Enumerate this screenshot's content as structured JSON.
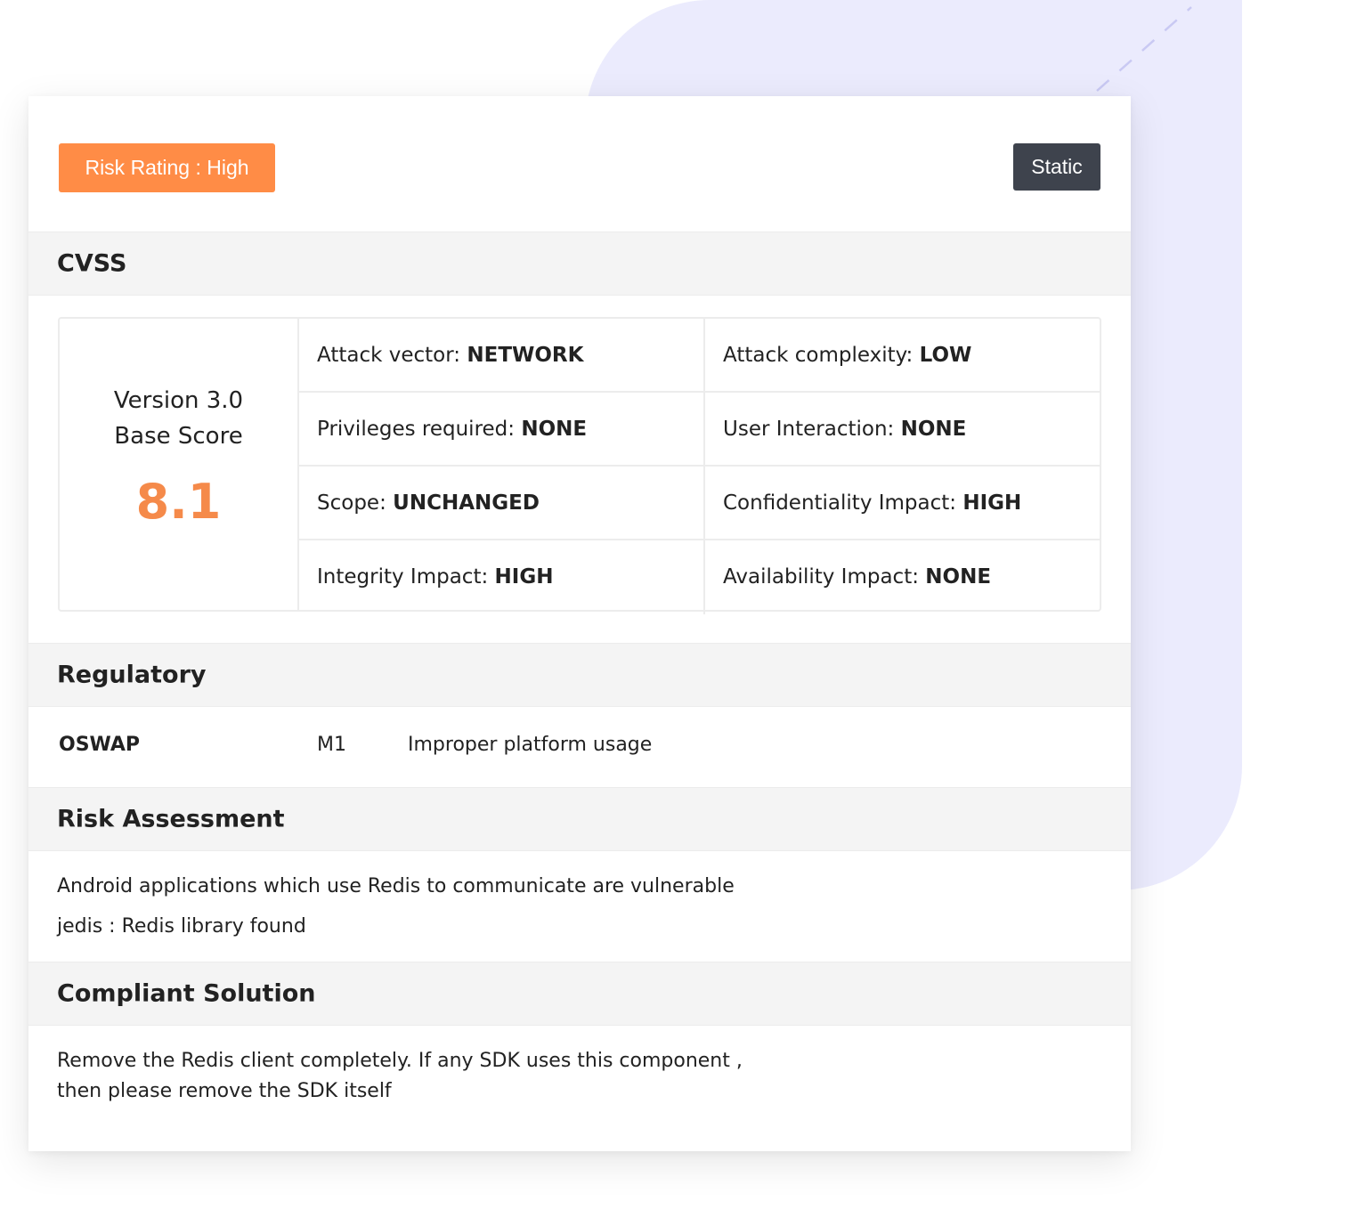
{
  "badges": {
    "risk_rating": "Risk Rating : High",
    "scan_type": "Static"
  },
  "cvss": {
    "section_title": "CVSS",
    "version": "Version 3.0",
    "base_score_label": "Base Score",
    "base_score": "8.1",
    "metrics": [
      {
        "label": "Attack vector: ",
        "value": "NETWORK"
      },
      {
        "label": "Attack complexity: ",
        "value": "LOW"
      },
      {
        "label": "Privileges required: ",
        "value": "NONE"
      },
      {
        "label": "User Interaction: ",
        "value": "NONE"
      },
      {
        "label": "Scope: ",
        "value": "UNCHANGED"
      },
      {
        "label": "Confidentiality Impact: ",
        "value": "HIGH"
      },
      {
        "label": "Integrity Impact: ",
        "value": "HIGH"
      },
      {
        "label": "Availability Impact: ",
        "value": "NONE"
      }
    ]
  },
  "regulatory": {
    "section_title": "Regulatory",
    "standard": "OSWAP",
    "code": "M1",
    "description": "Improper platform usage"
  },
  "risk_assessment": {
    "section_title": "Risk Assessment",
    "line1": "Android applications which use Redis to communicate are vulnerable",
    "line2": "jedis : Redis library found"
  },
  "compliant_solution": {
    "section_title": "Compliant Solution",
    "line1": "Remove the Redis client completely. If  any SDK uses this component ,",
    "line2": "then please remove the SDK itself"
  },
  "colors": {
    "risk_badge": "#ff8c46",
    "static_badge": "#3e434d",
    "score": "#f58a4a",
    "background_shape": "#ebebfd"
  }
}
